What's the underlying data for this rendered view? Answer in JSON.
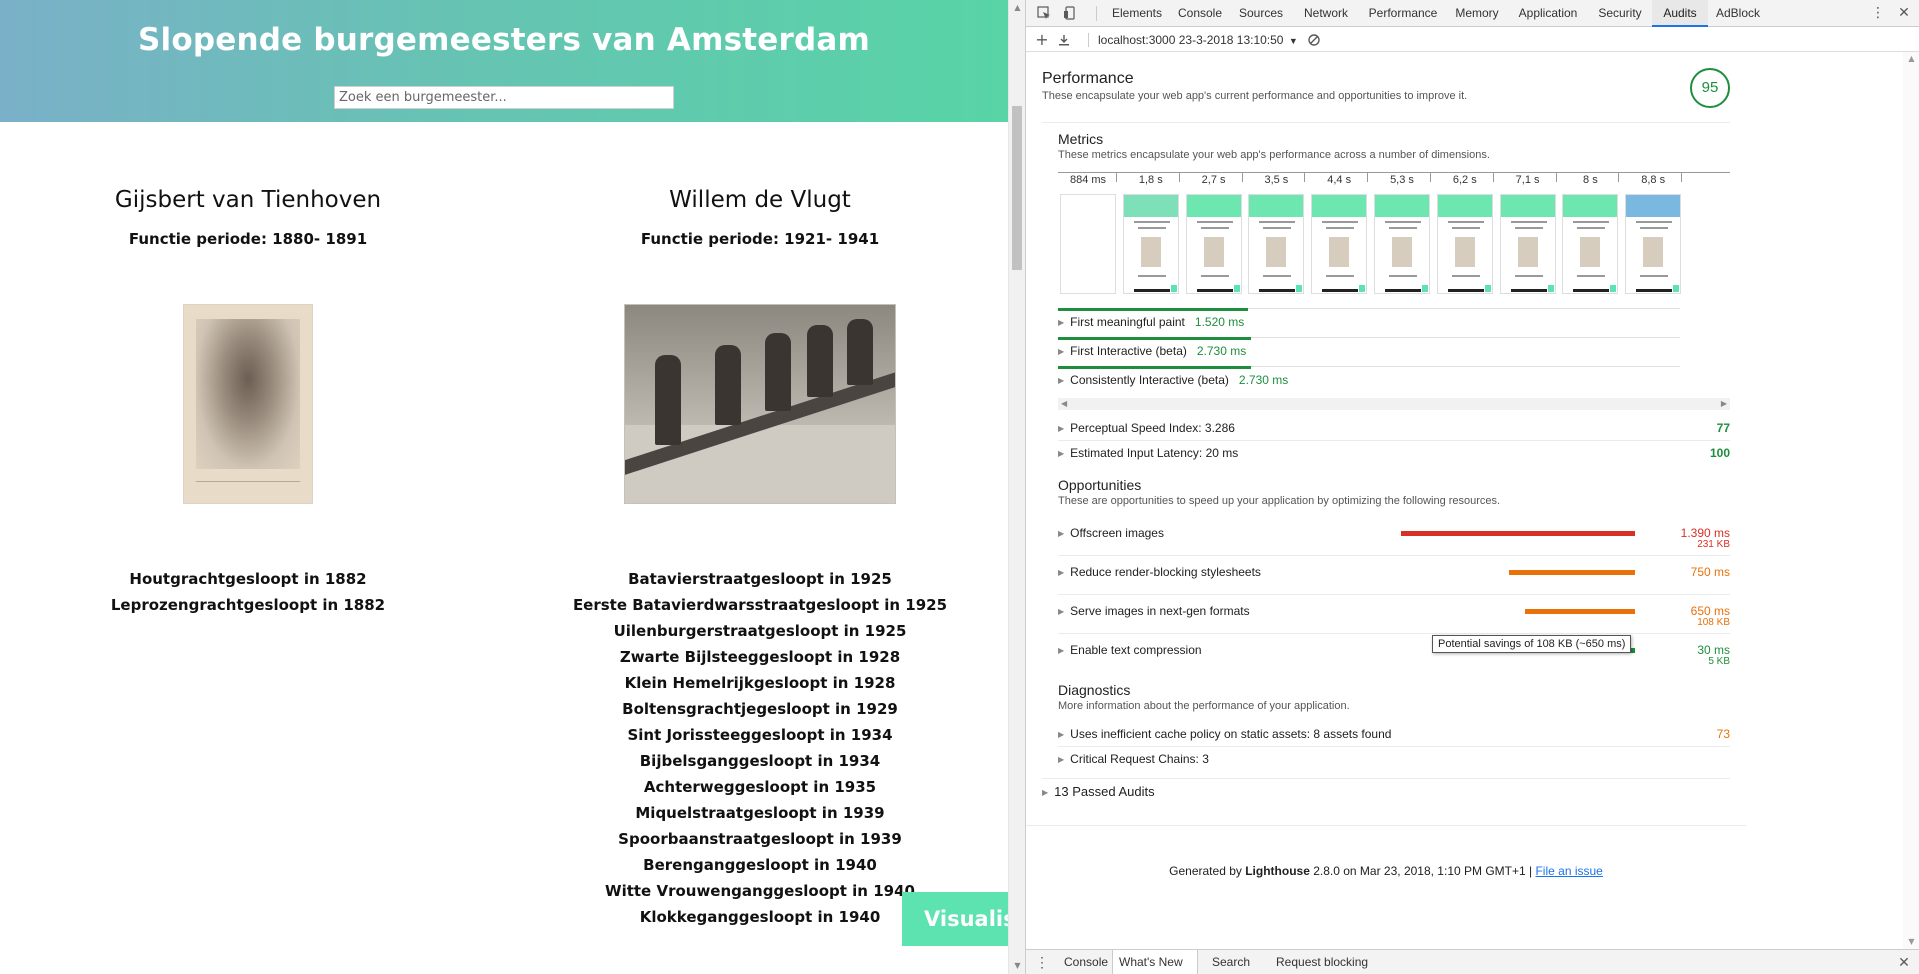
{
  "site": {
    "title": "Slopende burgemeesters van Amsterdam",
    "search_placeholder": "Zoek een burgemeester...",
    "visualis_label": "Visualis",
    "mayors": [
      {
        "name": "Gijsbert van Tienhoven",
        "period": "Functie periode: 1880- 1891",
        "streets": [
          "Houtgrachtgesloopt in 1882",
          "Leprozengrachtgesloopt in 1882"
        ]
      },
      {
        "name": "Willem de Vlugt",
        "period": "Functie periode: 1921- 1941",
        "streets": [
          "Batavierstraatgesloopt in 1925",
          "Eerste Batavierdwarsstraatgesloopt in 1925",
          "Uilenburgerstraatgesloopt in 1925",
          "Zwarte Bijlsteeggesloopt in 1928",
          "Klein Hemelrijkgesloopt in 1928",
          "Boltensgrachtjegesloopt in 1929",
          "Sint Jorissteeggesloopt in 1934",
          "Bijbelsganggesloopt in 1934",
          "Achterweggesloopt in 1935",
          "Miquelstraatgesloopt in 1939",
          "Spoorbaanstraatgesloopt in 1939",
          "Berenganggesloopt in 1940",
          "Witte Vrouwenganggesloopt in 1940",
          "Klokkeganggesloopt in 1940"
        ]
      }
    ]
  },
  "devtools": {
    "tabs": [
      "Elements",
      "Console",
      "Sources",
      "Network",
      "Performance",
      "Memory",
      "Application",
      "Security",
      "Audits",
      "AdBlock"
    ],
    "active_tab": "Audits",
    "report_label": "localhost:3000 23-3-2018 13:10:50",
    "performance": {
      "title": "Performance",
      "description": "These encapsulate your web app's current performance and opportunities to improve it.",
      "score": "95"
    },
    "metrics": {
      "title": "Metrics",
      "description": "These metrics encapsulate your web app's performance across a number of dimensions.",
      "filmstrip_labels": [
        "884 ms",
        "1,8 s",
        "2,7 s",
        "3,5 s",
        "4,4 s",
        "5,3 s",
        "6,2 s",
        "7,1 s",
        "8 s",
        "8,8 s"
      ],
      "items": [
        {
          "label": "First meaningful paint",
          "value": "1.520 ms",
          "fraction": 0.305
        },
        {
          "label": "First Interactive (beta)",
          "value": "2.730 ms",
          "fraction": 0.31
        },
        {
          "label": "Consistently Interactive (beta)",
          "value": "2.730 ms",
          "fraction": 0.31
        }
      ],
      "scored": [
        {
          "label": "Perceptual Speed Index: 3.286",
          "score": "77"
        },
        {
          "label": "Estimated Input Latency: 20 ms",
          "score": "100"
        }
      ]
    },
    "opportunities": {
      "title": "Opportunities",
      "description": "These are opportunities to speed up your application by optimizing the following resources.",
      "items": [
        {
          "label": "Offscreen images",
          "value": "1.390 ms",
          "size": "231 KB",
          "fraction": 1.0,
          "color": "#d93025"
        },
        {
          "label": "Reduce render-blocking stylesheets",
          "value": "750 ms",
          "size": "",
          "fraction": 0.54,
          "color": "#e8710a"
        },
        {
          "label": "Serve images in next-gen formats",
          "value": "650 ms",
          "size": "108 KB",
          "fraction": 0.47,
          "color": "#e8710a"
        },
        {
          "label": "Enable text compression",
          "value": "30 ms",
          "size": "5 KB",
          "fraction": 0.022,
          "color": "#1e8e3e"
        }
      ],
      "tooltip": "Potential savings of 108 KB (~650 ms)"
    },
    "diagnostics": {
      "title": "Diagnostics",
      "description": "More information about the performance of your application.",
      "items": [
        {
          "label": "Uses inefficient cache policy on static assets: 8 assets found",
          "score": "73"
        },
        {
          "label": "Critical Request Chains: 3",
          "score": ""
        }
      ]
    },
    "passed": "13 Passed Audits",
    "footer": {
      "prefix": "Generated by ",
      "brand": "Lighthouse",
      "suffix": " 2.8.0 on Mar 23, 2018, 1:10 PM GMT+1 | ",
      "link": "File an issue"
    },
    "drawer_tabs": [
      "Console",
      "What's New",
      "Search",
      "Request blocking"
    ],
    "drawer_active": "What's New",
    "colors": {
      "good": "#1e8e3e",
      "average": "#e8710a",
      "poor": "#d93025",
      "accent": "#1a73e8"
    }
  }
}
